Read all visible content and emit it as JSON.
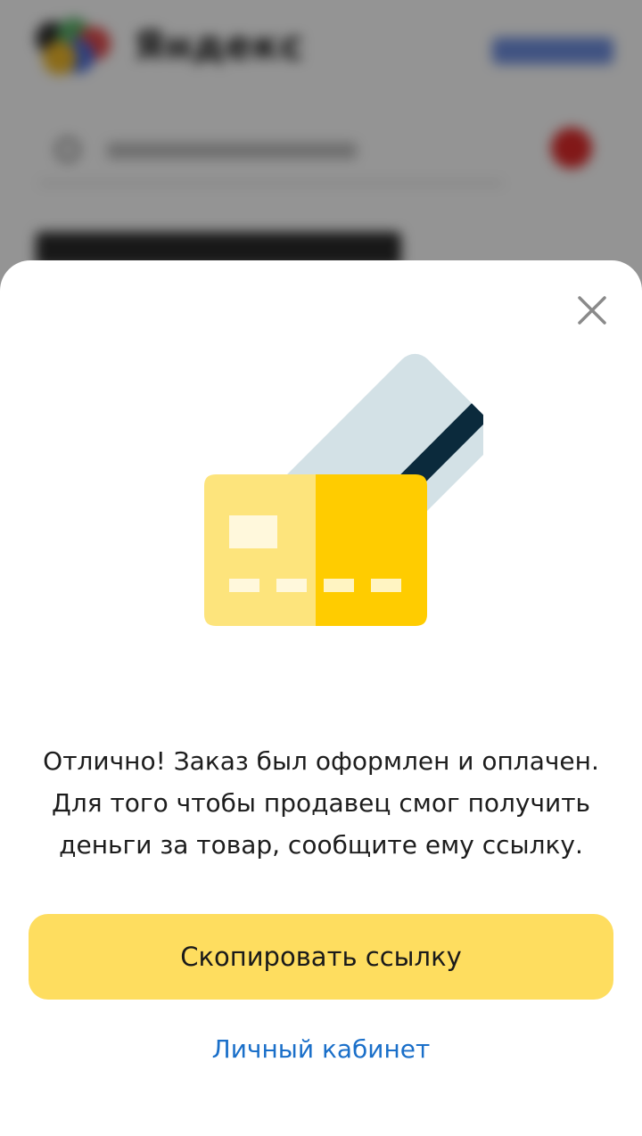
{
  "background_page": {
    "logo_text": "Яндекс"
  },
  "modal": {
    "close_icon": "close-icon",
    "illustration_icon": "credit-card-icon",
    "message_lines": [
      "Отлично! Заказ был оформлен и оплачен.",
      "Для того чтобы продавец смог получить",
      "деньги за товар, сообщите ему ссылку."
    ],
    "copy_button_label": "Скопировать ссылку",
    "cabinet_link_label": "Личный кабинет"
  },
  "colors": {
    "primary_button": "#fedd5f",
    "link": "#1a6fc9",
    "card_front_left": "#fde47c",
    "card_front_right": "#ffcc00",
    "card_back": "#d3e1e6",
    "card_stripe": "#0b2a3c"
  }
}
